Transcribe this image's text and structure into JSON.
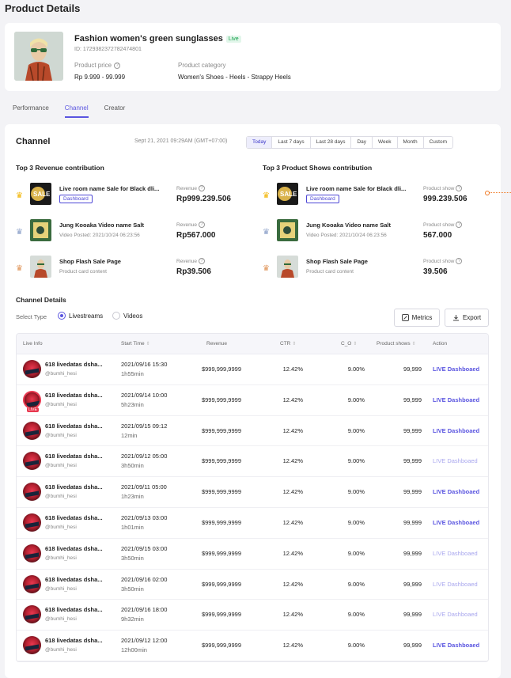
{
  "page_title": "Product Details",
  "product": {
    "name": "Fashion women's green sunglasses",
    "live_badge": "Live",
    "id_text": "ID: 1729382372782474801",
    "price_label": "Product price",
    "price_value": "Rp 9.999 - 99.999",
    "category_label": "Product category",
    "category_value": "Women's Shoes - Heels - Strappy Heels"
  },
  "tabs": [
    {
      "label": "Performance"
    },
    {
      "label": "Channel"
    },
    {
      "label": "Creator"
    }
  ],
  "channel": {
    "title": "Channel",
    "datetime": "Sept 21, 2021 09:29AM (GMT+07:00)",
    "ranges": [
      "Today",
      "Last 7 days",
      "Last 28 days",
      "Day",
      "Week",
      "Month",
      "Custom"
    ],
    "active_range": "Today"
  },
  "revenue_contrib": {
    "title": "Top 3 Revenue contribution",
    "metric_label": "Revenue",
    "items": [
      {
        "rank_icon": "gold-crown-icon",
        "title": "Live room name Sale for Black dli...",
        "badge": "Dashboard",
        "value": "Rp999.239.506"
      },
      {
        "rank_icon": "silver-crown-icon",
        "title": "Jung Kooaka Video name Salt",
        "sub": "Video Posted: 2021/10/24 06:23:56",
        "value": "Rp567.000"
      },
      {
        "rank_icon": "bronze-crown-icon",
        "title": "Shop Flash Sale Page",
        "sub": "Product card content",
        "value": "Rp39.506"
      }
    ]
  },
  "shows_contrib": {
    "title": "Top 3 Product Shows contribution",
    "metric_label": "Product show",
    "items": [
      {
        "rank_icon": "gold-crown-icon",
        "title": "Live room name Sale for Black dli...",
        "badge": "Dashboard",
        "value": "999.239.506"
      },
      {
        "rank_icon": "silver-crown-icon",
        "title": "Jung Kooaka Video name Salt",
        "sub": "Video Posted: 2021/10/24 06:23:56",
        "value": "567.000"
      },
      {
        "rank_icon": "bronze-crown-icon",
        "title": "Shop Flash Sale Page",
        "sub": "Product card content",
        "value": "39.506"
      }
    ]
  },
  "details": {
    "title": "Channel Details",
    "select_type_label": "Select Type",
    "type_options": [
      "Livestreams",
      "Videos"
    ],
    "selected_type": "Livestreams",
    "metrics_label": "Metrics",
    "export_label": "Export",
    "columns": [
      "Live Info",
      "Start Time",
      "Revenue",
      "CTR",
      "C_O",
      "Product shows",
      "Action"
    ],
    "rows": [
      {
        "name": "618 livedatas dsha...",
        "user": "@bumhi_hesi",
        "date": "2021/09/16 15:30",
        "dur": "1h55min",
        "revenue": "$999,999,9999",
        "ctr": "12.42%",
        "co": "9.00%",
        "shows": "99,999",
        "action": "LIVE Dashboaed",
        "enabled": true,
        "live": false
      },
      {
        "name": "618 livedatas dsha...",
        "user": "@bumhi_hesi",
        "date": "2021/09/14 10:00",
        "dur": "5h23min",
        "revenue": "$999,999,9999",
        "ctr": "12.42%",
        "co": "9.00%",
        "shows": "99,999",
        "action": "LIVE Dashboaed",
        "enabled": true,
        "live": true,
        "live_tag": "LIVE"
      },
      {
        "name": "618 livedatas dsha...",
        "user": "@bumhi_hesi",
        "date": "2021/09/15 09:12",
        "dur": "12min",
        "revenue": "$999,999,9999",
        "ctr": "12.42%",
        "co": "9.00%",
        "shows": "99,999",
        "action": "LIVE Dashboaed",
        "enabled": true,
        "live": false
      },
      {
        "name": "618 livedatas dsha...",
        "user": "@bumhi_hesi",
        "date": "2021/09/12 05:00",
        "dur": "3h50min",
        "revenue": "$999,999,9999",
        "ctr": "12.42%",
        "co": "9.00%",
        "shows": "99,999",
        "action": "LIVE Dashboaed",
        "enabled": false,
        "live": false
      },
      {
        "name": "618 livedatas dsha...",
        "user": "@bumhi_hesi",
        "date": "2021/09/11 05:00",
        "dur": "1h23min",
        "revenue": "$999,999,9999",
        "ctr": "12.42%",
        "co": "9.00%",
        "shows": "99,999",
        "action": "LIVE Dashboaed",
        "enabled": true,
        "live": false
      },
      {
        "name": "618 livedatas dsha...",
        "user": "@bumhi_hesi",
        "date": "2021/09/13 03:00",
        "dur": "1h01min",
        "revenue": "$999,999,9999",
        "ctr": "12.42%",
        "co": "9.00%",
        "shows": "99,999",
        "action": "LIVE Dashboaed",
        "enabled": true,
        "live": false
      },
      {
        "name": "618 livedatas dsha...",
        "user": "@bumhi_hesi",
        "date": "2021/09/15 03:00",
        "dur": "3h50min",
        "revenue": "$999,999,9999",
        "ctr": "12.42%",
        "co": "9.00%",
        "shows": "99,999",
        "action": "LIVE Dashboaed",
        "enabled": false,
        "live": false
      },
      {
        "name": "618 livedatas dsha...",
        "user": "@bumhi_hesi",
        "date": "2021/09/16 02:00",
        "dur": "3h50min",
        "revenue": "$999,999,9999",
        "ctr": "12.42%",
        "co": "9.00%",
        "shows": "99,999",
        "action": "LIVE Dashboaed",
        "enabled": false,
        "live": false
      },
      {
        "name": "618 livedatas dsha...",
        "user": "@bumhi_hesi",
        "date": "2021/09/16 18:00",
        "dur": "9h32min",
        "revenue": "$999,999,9999",
        "ctr": "12.42%",
        "co": "9.00%",
        "shows": "99,999",
        "action": "LIVE Dashboaed",
        "enabled": false,
        "live": false
      },
      {
        "name": "618 livedatas dsha...",
        "user": "@bumhi_hesi",
        "date": "2021/09/12 12:00",
        "dur": "12h00min",
        "revenue": "$999,999,9999",
        "ctr": "12.42%",
        "co": "9.00%",
        "shows": "99,999",
        "action": "LIVE Dashboaed",
        "enabled": true,
        "live": false
      }
    ]
  }
}
